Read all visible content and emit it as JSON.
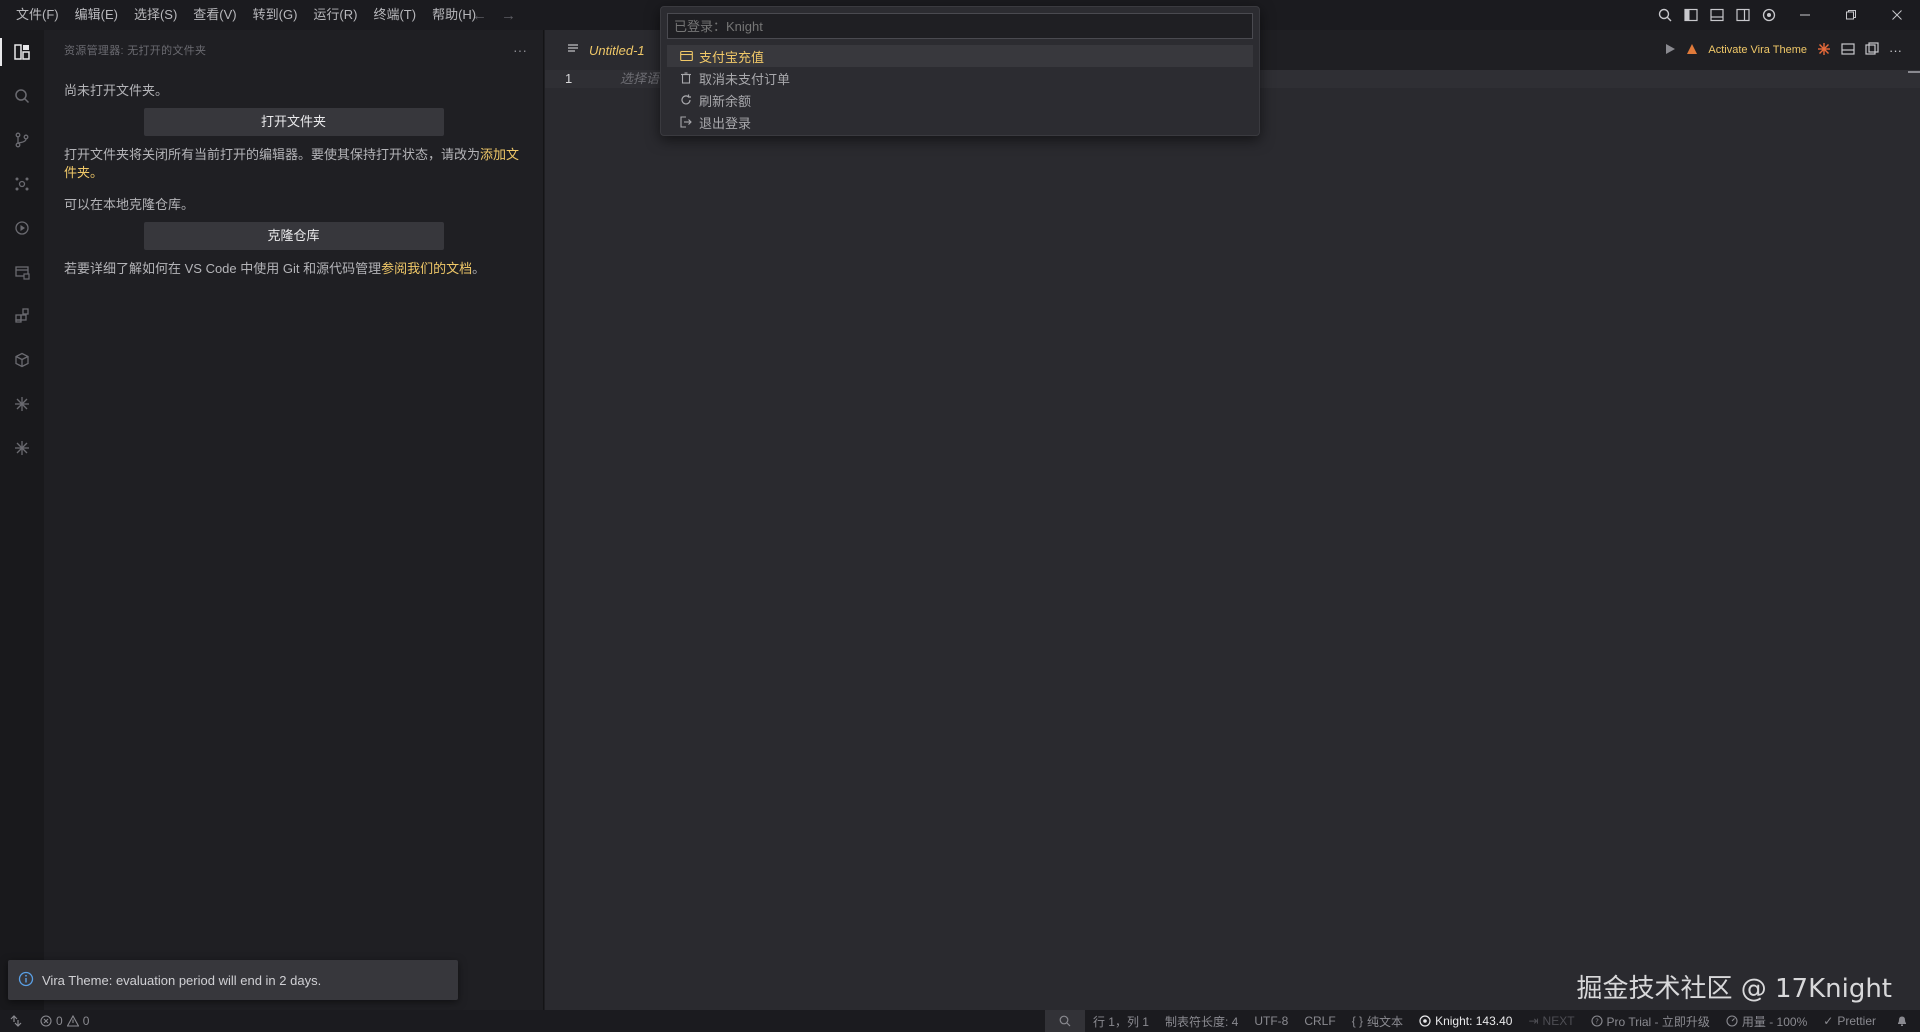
{
  "menu": {
    "items": [
      "文件(F)",
      "编辑(E)",
      "选择(S)",
      "查看(V)",
      "转到(G)",
      "运行(R)",
      "终端(T)",
      "帮助(H)"
    ]
  },
  "sidebar": {
    "title": "资源管理器: 无打开的文件夹",
    "no_folder_text": "尚未打开文件夹。",
    "open_folder_button": "打开文件夹",
    "close_editors_text": "打开文件夹将关闭所有当前打开的编辑器。要使其保持打开状态，请改为",
    "add_folder_link": "添加文件夹",
    "period": "。",
    "clone_text": "可以在本地克隆仓库。",
    "clone_button": "克隆仓库",
    "docs_text": "若要详细了解如何在 VS Code 中使用 Git 和源代码管理",
    "docs_link": "参阅我们的文档",
    "docs_period": "。"
  },
  "editor": {
    "tab_title": "Untitled-1",
    "line_number": "1",
    "code_text": "选择语",
    "activate_vira": "Activate Vira Theme"
  },
  "quickpick": {
    "placeholder": "已登录：Knight",
    "items": [
      {
        "label": "支付宝充值",
        "icon": "wallet-icon"
      },
      {
        "label": "取消未支付订单",
        "icon": "trash-icon"
      },
      {
        "label": "刷新余额",
        "icon": "refresh-icon"
      },
      {
        "label": "退出登录",
        "icon": "sign-out-icon"
      }
    ]
  },
  "notification": {
    "text": "Vira Theme: evaluation period will end in 2 days."
  },
  "watermark": "掘金技术社区 @ 17Knight",
  "statusbar": {
    "errors": "0",
    "warnings": "0",
    "position": "行 1，列 1",
    "tab_size": "制表符长度: 4",
    "encoding": "UTF-8",
    "eol": "CRLF",
    "language": "纯文本",
    "knight": "Knight: 143.40",
    "next": "NEXT",
    "pro_trial": "Pro Trial - 立即升级",
    "usage": "用量 - 100%",
    "prettier": "Prettier"
  },
  "colors": {
    "accent": "#f0c868",
    "background": "#1e1e22",
    "editor": "#2a2a2f"
  }
}
